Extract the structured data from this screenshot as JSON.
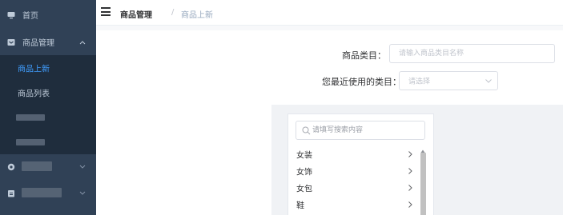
{
  "sidebar": {
    "items": [
      {
        "label": "首页",
        "icon": "monitor-icon"
      },
      {
        "label": "商品管理",
        "icon": "box-icon",
        "expanded": true,
        "children": [
          {
            "label": "商品上新",
            "active": true
          },
          {
            "label": "商品列表"
          },
          {
            "label": "",
            "redacted": true
          },
          {
            "label": "",
            "redacted": true
          }
        ]
      },
      {
        "label": "",
        "icon": "settings-icon",
        "redacted": true
      },
      {
        "label": "",
        "icon": "clipboard-icon",
        "redacted": true
      }
    ]
  },
  "header": {
    "breadcrumb": [
      "商品管理",
      "商品上新"
    ],
    "separator": "/"
  },
  "form": {
    "category_label": "商品类目：",
    "category_placeholder": "请输入商品类目名称",
    "recent_label": "您最近使用的类目：",
    "recent_placeholder": "请选择"
  },
  "category_picker": {
    "search_placeholder": "请填写搜索内容",
    "items": [
      "女装",
      "女饰",
      "女包",
      "鞋"
    ]
  },
  "colors": {
    "sidebar_bg": "#304156",
    "submenu_bg": "#1f2d3d",
    "accent": "#409eff",
    "panel_bg": "#f0f2f5"
  }
}
